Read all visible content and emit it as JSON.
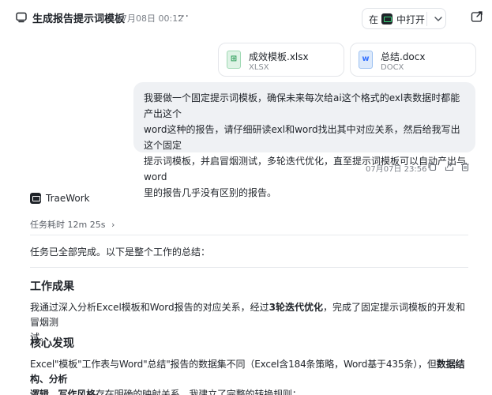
{
  "header": {
    "title": "生成报告提示词模板",
    "time": "07月08日 00:12",
    "more": "···",
    "open_in_prefix": "在",
    "open_in_label": "中打开",
    "icons": {
      "chat": "chat-bubble-icon",
      "share": "share-window-icon",
      "chevron": "chevron-down-icon"
    }
  },
  "files": [
    {
      "name": "成效模板.xlsx",
      "type": "XLSX",
      "glyph": "⊞",
      "color": "#2d9c5a"
    },
    {
      "name": "总结.docx",
      "type": "DOCX",
      "glyph": "w",
      "color": "#3370ff"
    }
  ],
  "user_message": {
    "lines": [
      "我要做一个固定提示词模板，确保未来每次给ai这个格式的exl表数据时都能产出这个",
      "word这种的报告，请仔细研读exl和word找出其中对应关系，然后给我写出这个固定",
      "提示词模板，并启冒烟测试，多轮迭代优化，直至提示词模板可以自动产出与word",
      "里的报告几乎没有区别的报告。"
    ],
    "time": "07月07日 23:56",
    "actions": [
      "copy-icon",
      "share-icon",
      "delete-icon"
    ]
  },
  "agent": {
    "name": "TraeWork",
    "task_time_label": "任务耗时 12m 25s",
    "task_time_chevron": "›",
    "intro": "任务已全部完成。以下是整个工作的总结：",
    "section1_title": "工作成果",
    "section1_text_a": "我通过深入分析Excel模板和Word报告的对应关系，经过",
    "section1_text_bold": "3轮迭代优化",
    "section1_text_b": "，完成了固定提示词模板的开发和冒烟测",
    "section1_text_c": "试。",
    "section2_title": "核心发现",
    "section2_line1_a": "Excel\"模板\"工作表与Word\"总结\"报告的数据集不同（Excel含184条策略，Word基于435条），但",
    "section2_line1_bold": "数据结构、分析",
    "section2_line2_bold": "逻辑、写作风格",
    "section2_line2_b": "存在明确的映射关系。我建立了完整的转换规则："
  },
  "colors": {
    "bubble_bg": "#eff1f4",
    "accent_green": "#2d9c5a",
    "accent_blue": "#3370ff"
  }
}
